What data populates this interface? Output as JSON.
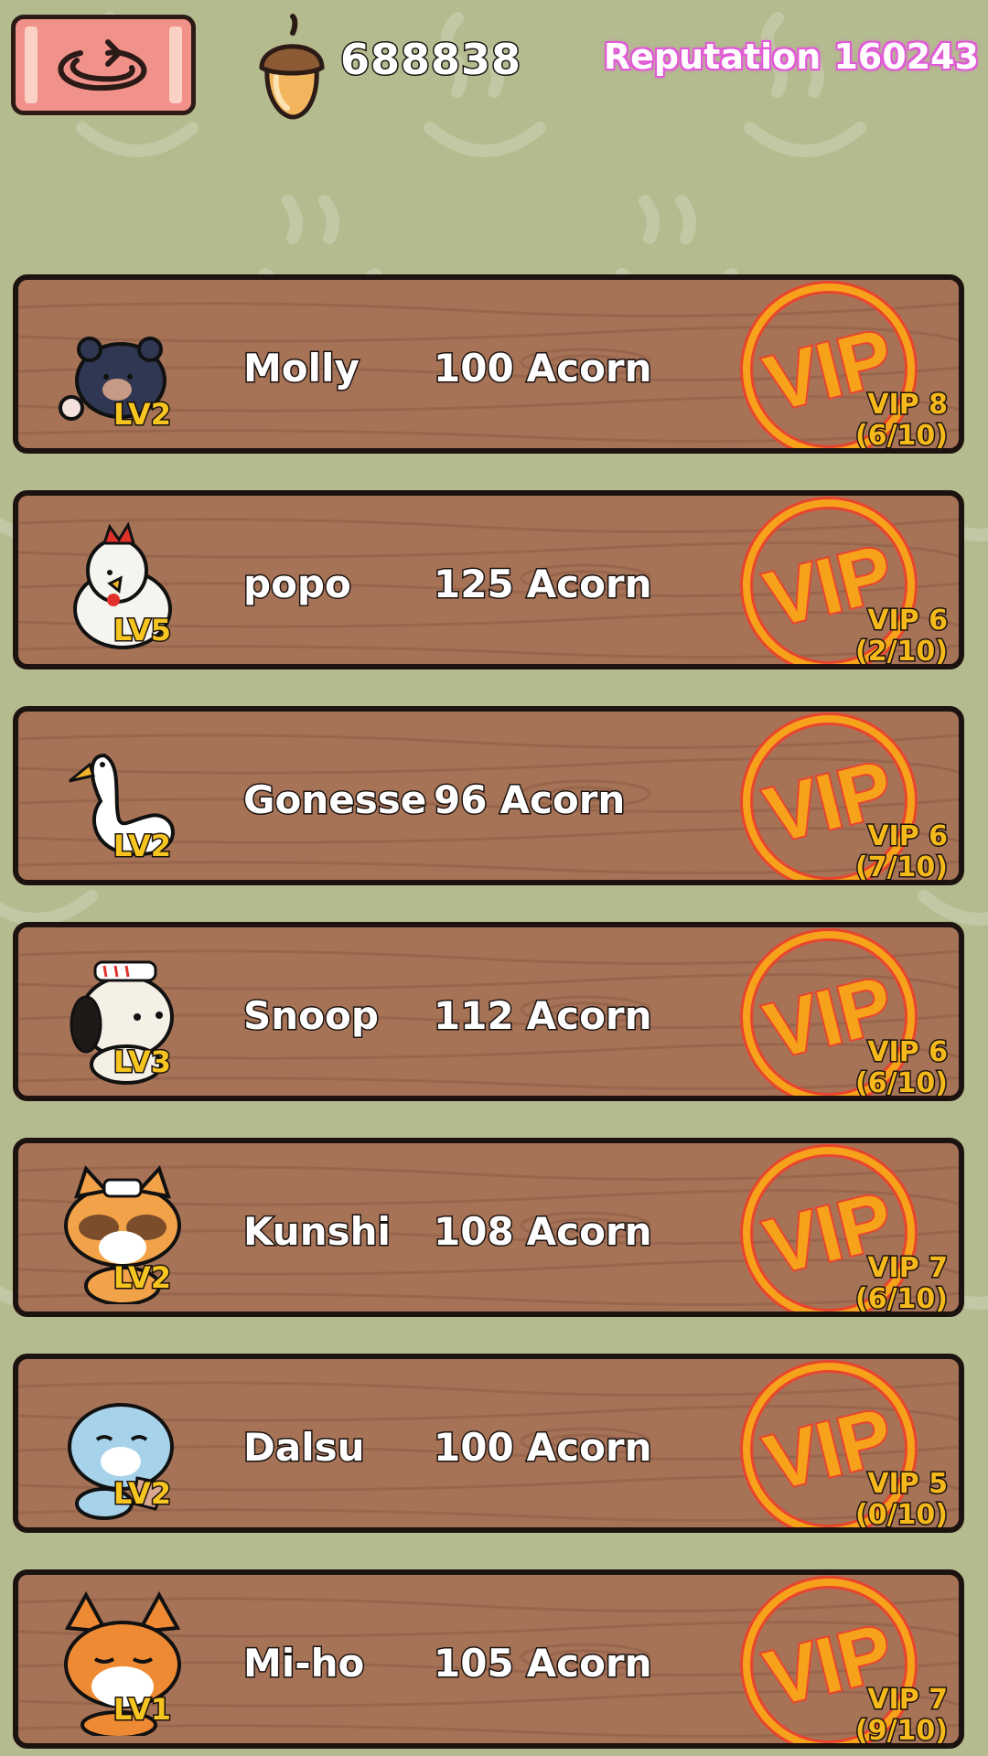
{
  "header": {
    "back_icon": "back-arrow-icon",
    "acorn_icon": "acorn-icon",
    "acorns": "688838",
    "reputation_label": "Reputation",
    "reputation_value": "160243"
  },
  "colors": {
    "background": "#b4bb8f",
    "plank": "#a67357",
    "outline": "#1c1210",
    "level_text": "#f6c51f",
    "vip_ring": "#f39a1c",
    "reputation_glow": "#e25ad8",
    "back_button": "#f1928a"
  },
  "customers": [
    {
      "name": "Molly",
      "price": "100",
      "currency": "Acorn",
      "level": "LV2",
      "vip_level": "VIP 8",
      "vip_progress": "(6/10)",
      "avatar": "bear-icon"
    },
    {
      "name": "popo",
      "price": "125",
      "currency": "Acorn",
      "level": "LV5",
      "vip_level": "VIP 6",
      "vip_progress": "(2/10)",
      "avatar": "chicken-icon"
    },
    {
      "name": "Gonesse",
      "price": "96",
      "currency": "Acorn",
      "level": "LV2",
      "vip_level": "VIP 6",
      "vip_progress": "(7/10)",
      "avatar": "swan-icon"
    },
    {
      "name": "Snoop",
      "price": "112",
      "currency": "Acorn",
      "level": "LV3",
      "vip_level": "VIP 6",
      "vip_progress": "(6/10)",
      "avatar": "dog-icon"
    },
    {
      "name": "Kunshi",
      "price": "108",
      "currency": "Acorn",
      "level": "LV2",
      "vip_level": "VIP 7",
      "vip_progress": "(6/10)",
      "avatar": "raccoon-icon"
    },
    {
      "name": "Dalsu",
      "price": "100",
      "currency": "Acorn",
      "level": "LV2",
      "vip_level": "VIP 5",
      "vip_progress": "(0/10)",
      "avatar": "otter-icon"
    },
    {
      "name": "Mi-ho",
      "price": "105",
      "currency": "Acorn",
      "level": "LV1",
      "vip_level": "VIP 7",
      "vip_progress": "(9/10)",
      "avatar": "fox-icon"
    }
  ],
  "vip_badge_text": "VIP"
}
